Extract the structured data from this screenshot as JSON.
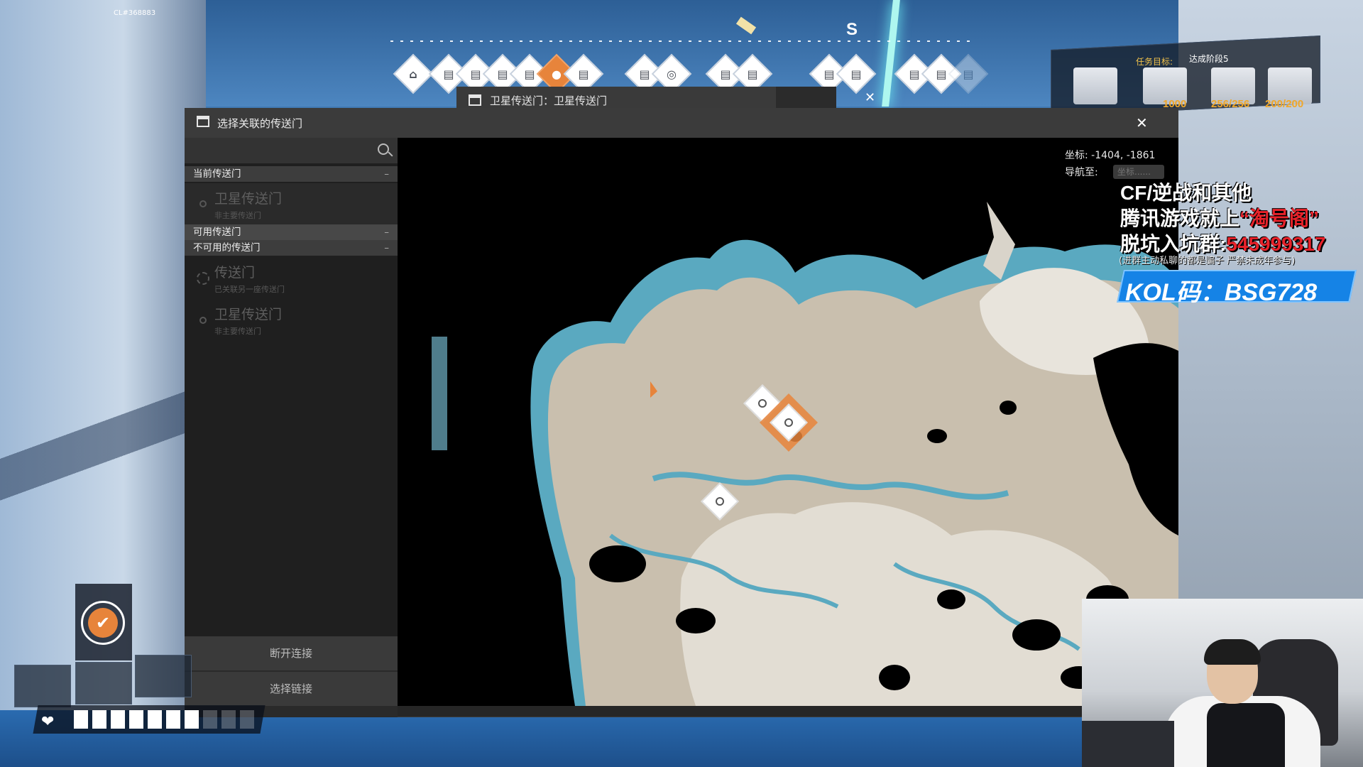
{
  "build": "CL#368883",
  "compass": {
    "heading": "S"
  },
  "mission": {
    "label": "任务目标:",
    "stage": "达成阶段5",
    "counts": [
      "1000",
      "256/256",
      "200/200"
    ]
  },
  "sub_window": {
    "title": "卫星传送门：卫星传送门",
    "close": "✕"
  },
  "dialog": {
    "title": "选择关联的传送门",
    "close": "✕",
    "search": {
      "placeholder": ""
    },
    "sections": {
      "current": "当前传送门",
      "available": "可用传送门",
      "unavailable": "不可用的传送门",
      "collapse": "–"
    },
    "current_portal": {
      "name": "卫星传送门",
      "sub": "非主要传送门"
    },
    "unavailable_portals": [
      {
        "name": "传送门",
        "sub": "已关联另一座传送门"
      },
      {
        "name": "卫星传送门",
        "sub": "非主要传送门"
      }
    ],
    "buttons": {
      "disconnect": "断开连接",
      "select_link": "选择链接"
    }
  },
  "map": {
    "coordinates": "坐标: -1404, -1861",
    "navigate_label": "导航至:",
    "navigate_placeholder": "坐标......"
  },
  "stream_overlay": {
    "line1": "CF/逆战和其他",
    "line2_prefix": "腾讯游戏就上",
    "line2_highlight": "“淘号阁”",
    "line3_prefix": "脱坑入坑群:",
    "line3_number": "545999317",
    "line4": "(进群主动私聊的都是骗子 严禁未成年参与)",
    "kol": "KOL码：BSG728"
  },
  "hud": {
    "check_glyph": "✔",
    "health_segments_filled": 7,
    "health_segments_total": 10
  },
  "colors": {
    "accent_orange": "#e7843b",
    "map_land": "#c9bfae",
    "map_water": "#5aa9c0",
    "dialog_bg": "#262626"
  }
}
